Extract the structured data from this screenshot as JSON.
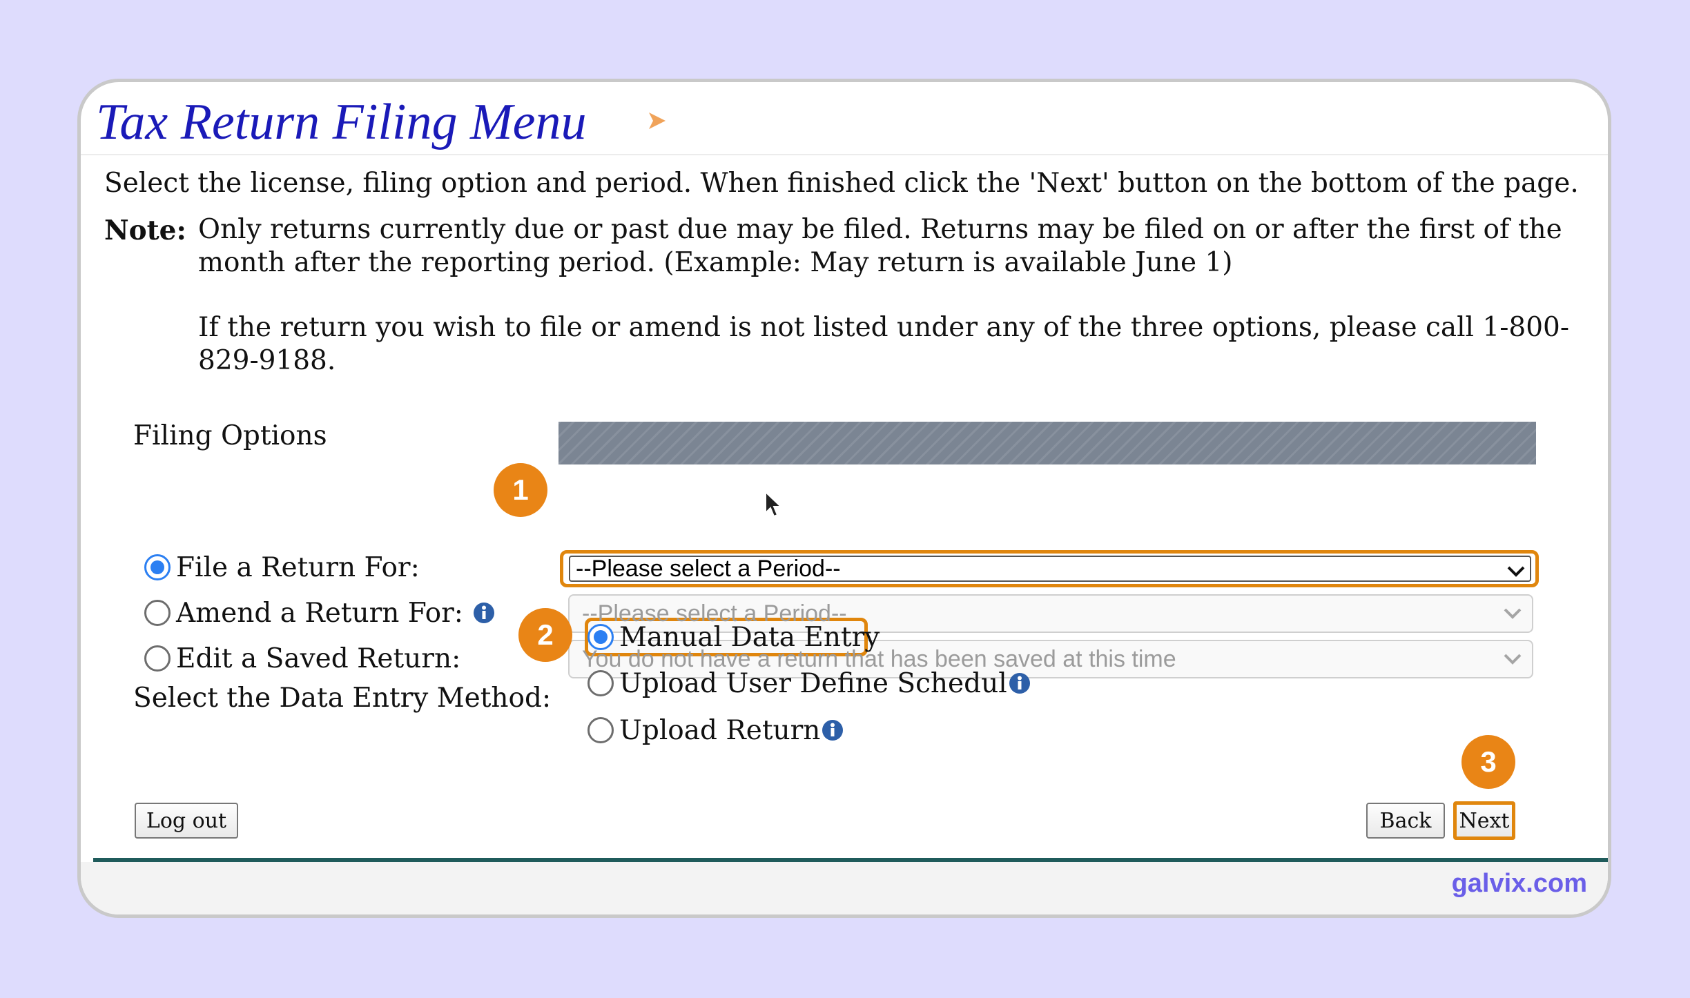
{
  "page": {
    "title": "Tax Return Filing Menu",
    "intro": "Select the license, filing option and period. When finished click the 'Next' button on the bottom of the page.",
    "note_label": "Note:",
    "note_line1": "Only returns currently due or past due may be filed. Returns may be filed on or after the first of the month after the reporting period. (Example: May return is available June 1)",
    "note_line2": "If the return you wish to file or amend is not listed under any of the three options, please call 1-800-829-9188."
  },
  "filing": {
    "section_label": "Filing Options",
    "options": [
      {
        "label": "File a Return For:",
        "checked": true,
        "select_value": "--Please select a Period--",
        "select_state": "active"
      },
      {
        "label": "Amend a Return For:",
        "checked": false,
        "select_value": "--Please select a Period--",
        "select_state": "disabled",
        "has_info": true
      },
      {
        "label": "Edit a Saved Return:",
        "checked": false,
        "select_value": "You do not have a return that has been saved at this time",
        "select_state": "disabled"
      }
    ]
  },
  "method": {
    "label": "Select the Data Entry Method:",
    "options": [
      {
        "label": "Manual Data Entry",
        "checked": true
      },
      {
        "label": "Upload User Define Schedul",
        "checked": false,
        "has_info": true
      },
      {
        "label": "Upload Return",
        "checked": false,
        "has_info": true
      }
    ]
  },
  "buttons": {
    "logout": "Log out",
    "back": "Back",
    "next": "Next"
  },
  "badges": [
    "1",
    "2",
    "3"
  ],
  "footer": {
    "brand": "galvix.com"
  },
  "colors": {
    "background": "#dedcfd",
    "title": "#1a1ab8",
    "highlight": "#e0860d",
    "badge": "#e98516",
    "radio_selected": "#2b7ff2",
    "brand": "#6a5ee8"
  },
  "icons": [
    "info-icon",
    "chevron-down-icon",
    "mouse-cursor-icon",
    "arrow-right-icon"
  ]
}
